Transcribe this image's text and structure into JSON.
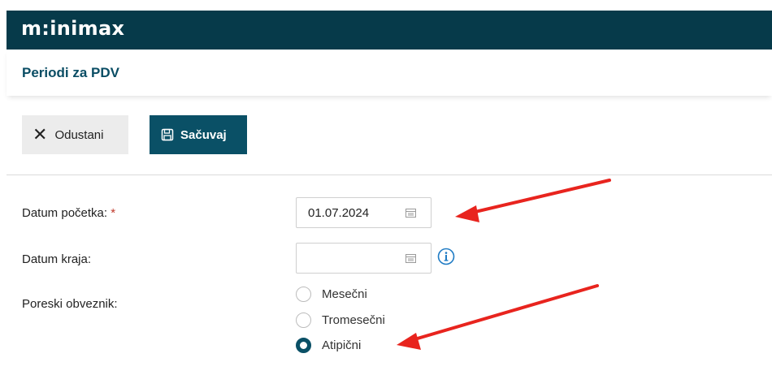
{
  "app": {
    "logo": "m:inimax"
  },
  "page": {
    "title": "Periodi za PDV"
  },
  "toolbar": {
    "cancel_label": "Odustani",
    "save_label": "Sačuvaj"
  },
  "form": {
    "start_date": {
      "label": "Datum početka:",
      "required_mark": "*",
      "value": "01.07.2024"
    },
    "end_date": {
      "label": "Datum kraja:",
      "value": ""
    },
    "taxpayer": {
      "label": "Poreski obveznik:",
      "options": [
        {
          "label": "Mesečni",
          "checked": false
        },
        {
          "label": "Tromesečni",
          "checked": false
        },
        {
          "label": "Atipični",
          "checked": true
        }
      ]
    }
  },
  "icons": {
    "cancel": "close-icon",
    "save": "floppy-disk-icon",
    "calendar": "calendar-icon",
    "info": "info-icon"
  },
  "colors": {
    "header_bg": "#063a4a",
    "accent": "#0a5066",
    "title": "#0a4d64",
    "required": "#c0392b",
    "annotation_arrow": "#e8241e"
  }
}
